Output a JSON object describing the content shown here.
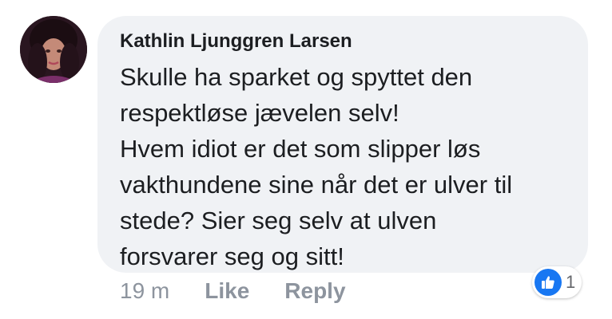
{
  "comment": {
    "author": "Kathlin Ljunggren Larsen",
    "text": "Skulle ha sparket og spyttet den\nrespektløse jævelen selv!\nHvem idiot er det som slipper løs\nvakthundene sine når det er ulver til\nstede? Sier seg selv at ulven\nforsvarer seg og sitt!",
    "time": "19 m",
    "like_label": "Like",
    "reply_label": "Reply",
    "reaction_count": "1",
    "reaction_icon": "thumbs-up-icon",
    "colors": {
      "bubble": "#f0f2f5",
      "text": "#1c1e21",
      "meta": "#8d949e",
      "like_badge": "#1877f2"
    }
  }
}
